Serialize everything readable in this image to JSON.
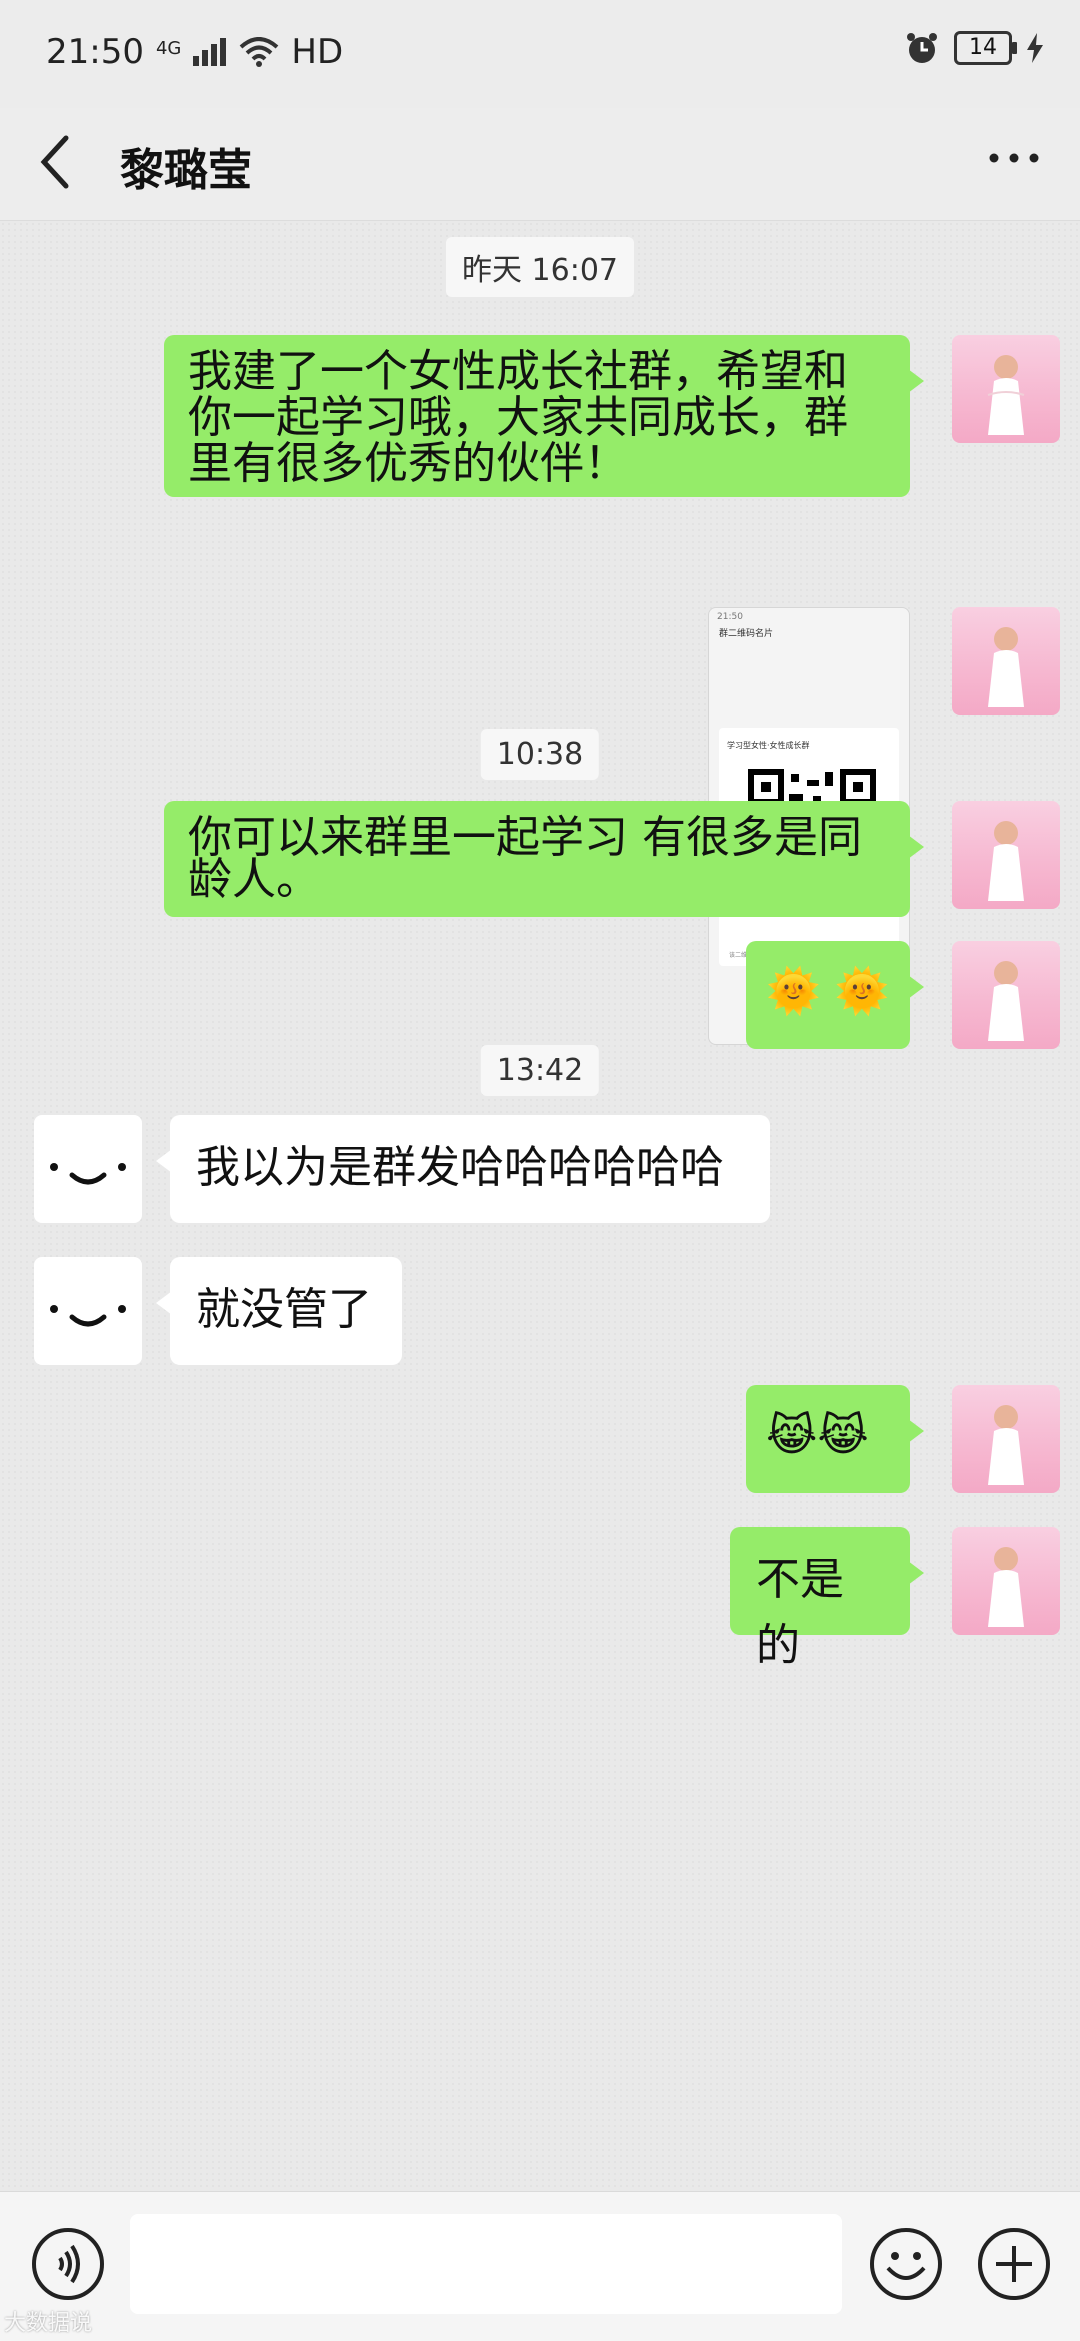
{
  "status_bar": {
    "time": "21:50",
    "network": "4G",
    "hd": "HD",
    "battery": "14"
  },
  "header": {
    "title": "黎璐莹",
    "back_icon": "chevron-left-icon",
    "more_icon": "more-dots-icon"
  },
  "messages": {
    "ts1": "昨天 16:07",
    "m1": "我建了一个女性成长社群，希望和你一起学习哦，大家共同成长，群里有很多优秀的伙伴！",
    "m2_image_title": "群二维码名片",
    "m2_image_group": "学习型女性·女性成长群",
    "m2_image_caption": "该二维码7天内(有效)，重新进入将更新",
    "m2_image_status": "21:50",
    "ts2": "10:38",
    "m3": "你可以来群里一起学习  有很多是同龄人。",
    "m4": "🌞 🌞",
    "ts3": "13:42",
    "m5": "我以为是群发哈哈哈哈哈哈",
    "m6": "就没管了",
    "m7": "😹😹",
    "m8": "不是的"
  },
  "input_bar": {
    "placeholder": "",
    "voice_icon": "voice-icon",
    "emoji_icon": "emoji-icon",
    "plus_icon": "plus-icon"
  },
  "watermark": "大数据说"
}
